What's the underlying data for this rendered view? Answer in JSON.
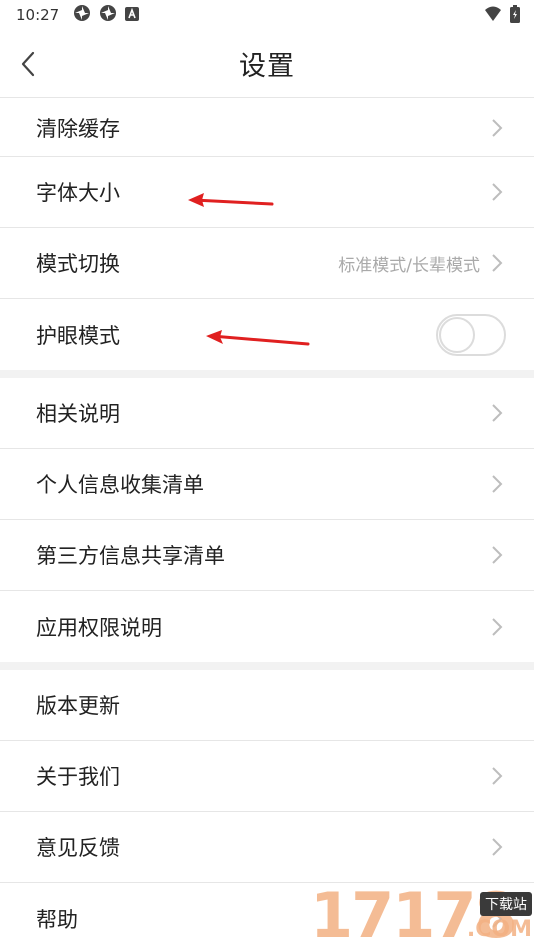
{
  "status_bar": {
    "time": "10:27",
    "icons": [
      "pinwheel-icon",
      "pinwheel-icon",
      "a-icon",
      "wifi-icon",
      "battery-icon"
    ]
  },
  "header": {
    "title": "设置"
  },
  "sections": [
    {
      "items": [
        {
          "label": "清除缓存",
          "type": "link"
        },
        {
          "label": "字体大小",
          "type": "link"
        },
        {
          "label": "模式切换",
          "type": "link",
          "value": "标准模式/长辈模式"
        },
        {
          "label": "护眼模式",
          "type": "toggle",
          "toggle_on": false
        }
      ]
    },
    {
      "items": [
        {
          "label": "相关说明",
          "type": "link"
        },
        {
          "label": "个人信息收集清单",
          "type": "link"
        },
        {
          "label": "第三方信息共享清单",
          "type": "link"
        },
        {
          "label": "应用权限说明",
          "type": "link"
        }
      ]
    },
    {
      "items": [
        {
          "label": "版本更新",
          "type": "plain"
        },
        {
          "label": "关于我们",
          "type": "link"
        },
        {
          "label": "意见反馈",
          "type": "link"
        },
        {
          "label": "帮助",
          "type": "link"
        }
      ]
    }
  ],
  "annotation": {
    "arrow_color": "#e02020"
  },
  "watermark": {
    "digits": "17178",
    "badge": "下载站",
    "suffix": ".COM"
  }
}
